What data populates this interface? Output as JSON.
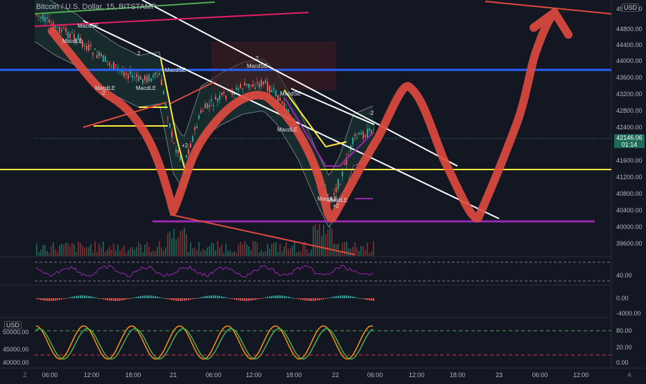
{
  "header": {
    "title": "Bitcoin / U.S. Dollar, 15, BITSTAMP"
  },
  "main_price_axis": {
    "currency_label": "USD",
    "ticks": [
      "45200.00",
      "44800.00",
      "44400.00",
      "44000.00",
      "43600.00",
      "43200.00",
      "42800.00",
      "42400.00",
      "41600.00",
      "41200.00",
      "40800.00",
      "40400.00",
      "40000.00",
      "39600.00"
    ],
    "current_price": "42146.06",
    "countdown": "01:14"
  },
  "indicator_1_axis": {
    "ticks": [
      "40.00"
    ]
  },
  "indicator_2_axis": {
    "ticks": [
      "0.00",
      "-4000.00"
    ]
  },
  "indicator_3": {
    "currency_label": "USD",
    "left_ticks": [
      "50000.00",
      "45000.00",
      "40000.00"
    ],
    "right_ticks": [
      "80.00",
      "20.00",
      "0.00"
    ]
  },
  "time_axis": {
    "ticks": [
      "06:00",
      "12:00",
      "18:00",
      "21",
      "06:00",
      "12:00",
      "18:00",
      "22",
      "06:00",
      "12:00",
      "18:00",
      "23",
      "06:00",
      "12:00"
    ]
  },
  "corner_buttons": {
    "left": "Z",
    "right": "A"
  },
  "annotations": {
    "labels": [
      "MacdLE",
      "MacdSE",
      "MacdLE",
      "MacdSE",
      "MacdLE",
      "MacdSE",
      "MacdLE",
      "MacdSE",
      "MacdLE",
      "MacdLE",
      "-2",
      "+2",
      "-2",
      "+2",
      "2",
      "-2"
    ]
  },
  "colors": {
    "background": "#131722",
    "drawing_red": "#e04a3f",
    "blue_line": "#2962ff",
    "yellow_line": "#ffeb3b",
    "purple_line": "#9c27b0",
    "white_line": "#ffffff",
    "green_line": "#4caf50",
    "magenta_line": "#e91e63",
    "price_tag": "#1e6b5a"
  }
}
